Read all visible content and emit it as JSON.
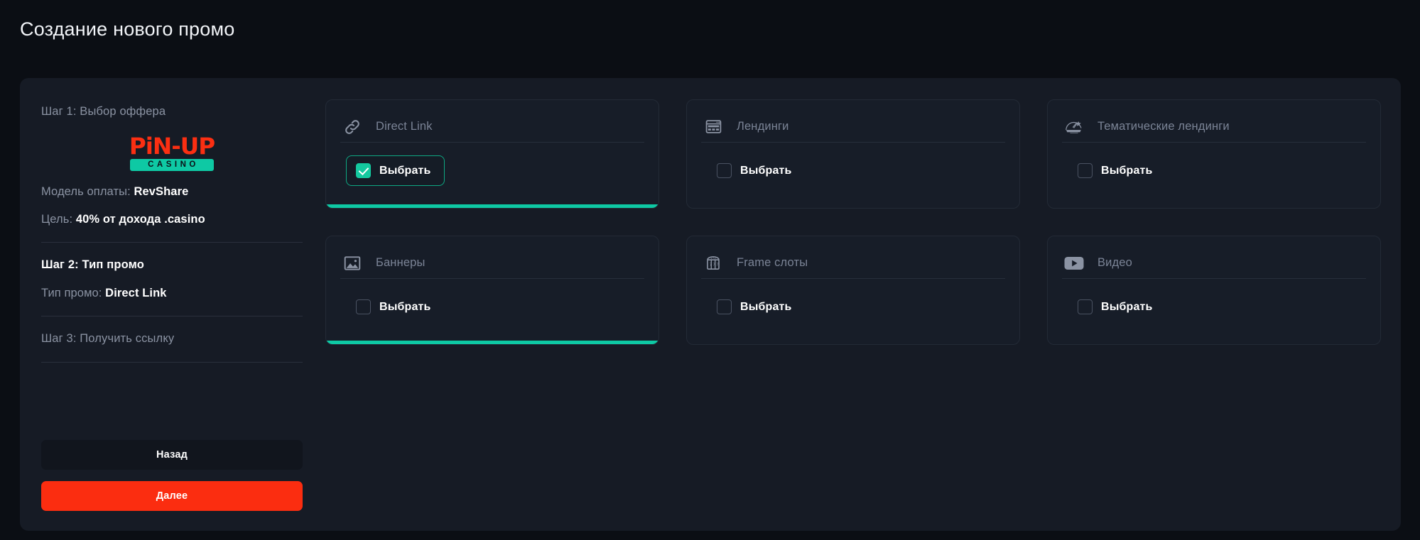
{
  "page": {
    "title": "Создание нового промо"
  },
  "theme": {
    "page_bg": "#0b0e14",
    "panel_bg": "#161b25",
    "card_bg": "#171d28",
    "accent_teal": "#0ec9a4",
    "accent_red": "#fb2d10",
    "muted_text": "#8b93a3",
    "bright_text": "#ffffff"
  },
  "sidebar": {
    "step1_label": "Шаг 1: Выбор оффера",
    "offer_logo": {
      "top_text": "PiN-UP",
      "bottom_text": "CASINO",
      "top_color": "#fb2f12",
      "bottom_bg": "#0ec9a4"
    },
    "payment_model": {
      "label": "Модель оплаты:",
      "value": "RevShare"
    },
    "goal": {
      "label": "Цель:",
      "value": "40% от дохода .casino"
    },
    "step2_label": "Шаг 2: Тип промо",
    "promo_type": {
      "label": "Тип промо:",
      "value": "Direct Link"
    },
    "step3_label": "Шаг 3: Получить ссылку",
    "back_button": "Назад",
    "next_button": "Далее"
  },
  "cards": [
    {
      "id": "direct-link",
      "title": "Direct Link",
      "icon": "link-icon",
      "choose_label": "Выбрать",
      "checked": true,
      "highlighted": true
    },
    {
      "id": "landings",
      "title": "Лендинги",
      "icon": "browser-window-icon",
      "choose_label": "Выбрать",
      "checked": false,
      "highlighted": false
    },
    {
      "id": "thematic-landings",
      "title": "Тематические лендинги",
      "icon": "emblem-badge-icon",
      "choose_label": "Выбрать",
      "checked": false,
      "highlighted": false
    },
    {
      "id": "banners",
      "title": "Баннеры",
      "icon": "image-icon",
      "choose_label": "Выбрать",
      "checked": false,
      "highlighted": true
    },
    {
      "id": "frame-slots",
      "title": "Frame слоты",
      "icon": "slot-machine-icon",
      "choose_label": "Выбрать",
      "checked": false,
      "highlighted": false
    },
    {
      "id": "video",
      "title": "Видео",
      "icon": "play-video-icon",
      "choose_label": "Выбрать",
      "checked": false,
      "highlighted": false
    }
  ]
}
